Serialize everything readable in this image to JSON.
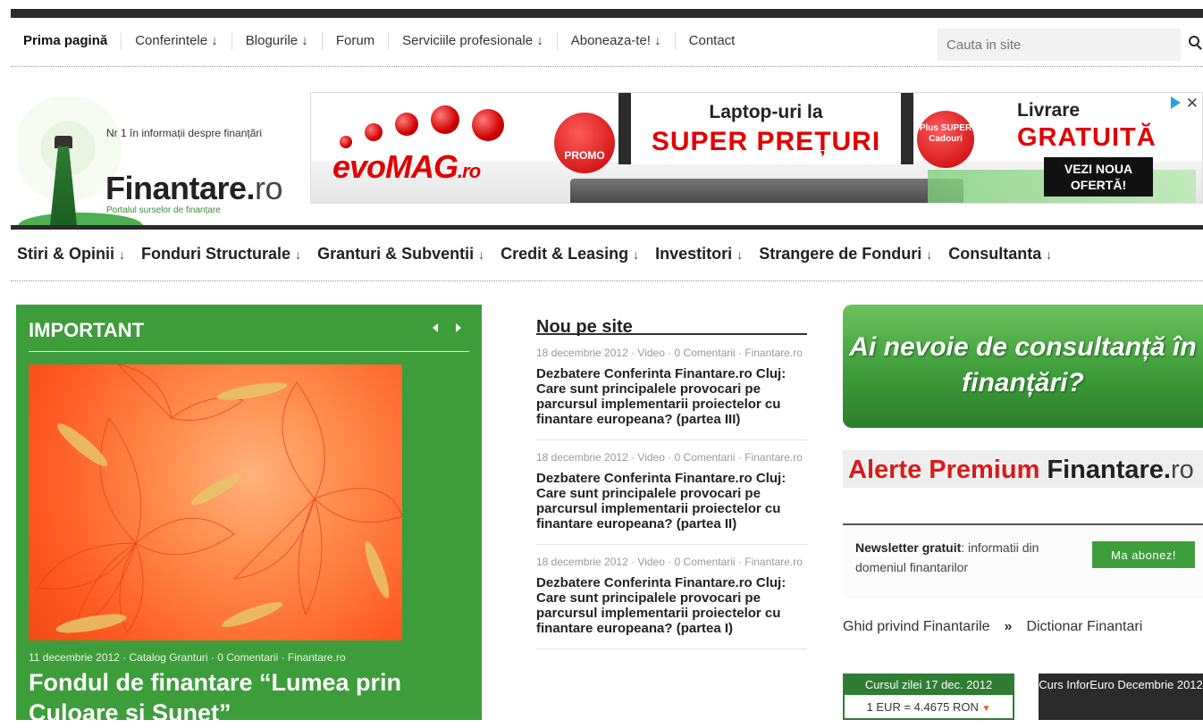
{
  "topnav": {
    "items": [
      "Prima pagină",
      "Conferintele ↓",
      "Blogurile ↓",
      "Forum",
      "Serviciile profesionale ↓",
      "Aboneaza-te! ↓",
      "Contact"
    ],
    "search_placeholder": "Cauta in site"
  },
  "logo": {
    "tagline": "Nr 1 în informații despre finanțări",
    "name": "Finantare.",
    "tld": "ro",
    "sub": "Portalul surselor de finanțare"
  },
  "banner": {
    "brand": "evoMAG",
    "brand_tld": ".ro",
    "promo": "PROMO",
    "line1": "Laptop-uri la",
    "line2": "SUPER PREȚURI",
    "plus_badge": "Plus SUPER Cadouri",
    "right1": "Livrare",
    "right2": "GRATUITĂ",
    "cta": "VEZI NOUA OFERTĂ!",
    "close": "✕"
  },
  "catnav": {
    "items": [
      {
        "label": "Stiri & Opinii",
        "arrow": "↓"
      },
      {
        "label": "Fonduri Structurale",
        "arrow": "↓"
      },
      {
        "label": "Granturi & Subventii",
        "arrow": "↓"
      },
      {
        "label": "Credit & Leasing",
        "arrow": "↓"
      },
      {
        "label": "Investitori",
        "arrow": "↓"
      },
      {
        "label": "Strangere de Fonduri",
        "arrow": "↓"
      },
      {
        "label": "Consultanta",
        "arrow": "↓"
      }
    ]
  },
  "important": {
    "title": "IMPORTANT",
    "meta": "11 decembrie 2012 · Catalog Granturi · 0 Comentarii · Finantare.ro",
    "headline": "Fondul de finantare “Lumea prin Culoare si Sunet”"
  },
  "nou": {
    "title": "Nou pe site",
    "items": [
      {
        "meta": "18 decembrie 2012 · Video · 0 Comentarii · Finantare.ro",
        "headline": "Dezbatere Conferinta Finantare.ro Cluj: Care sunt principalele provocari pe parcursul implementarii proiectelor cu finantare europeana? (partea III)"
      },
      {
        "meta": "18 decembrie 2012 · Video · 0 Comentarii · Finantare.ro",
        "headline": "Dezbatere Conferinta Finantare.ro Cluj: Care sunt principalele provocari pe parcursul implementarii proiectelor cu finantare europeana? (partea II)"
      },
      {
        "meta": "18 decembrie 2012 · Video · 0 Comentarii · Finantare.ro",
        "headline": "Dezbatere Conferinta Finantare.ro Cluj: Care sunt principalele provocari pe parcursul implementarii proiectelor cu finantare europeana? (partea I)"
      }
    ]
  },
  "consult": {
    "text": "Ai nevoie de consultanță în finanțări?"
  },
  "alerte": {
    "red": "Alerte Premium",
    "brand": "Finantare.",
    "tld": "ro"
  },
  "newsletter": {
    "bold": "Newsletter gratuit",
    "text": ": informatii din domeniul finantarilor",
    "button": "Ma abonez!"
  },
  "ghid": {
    "link1": "Ghid privind Finantarile",
    "sep": "»",
    "link2": "Dictionar Finantari"
  },
  "curs": {
    "head": "Cursul zilei 17 dec. 2012",
    "value": "1 EUR = 4.4675 RON",
    "trend_icon": "▼"
  },
  "inforeuro": {
    "text": "Curs InforEuro Decembrie 2012"
  },
  "colors": {
    "green": "#3e9d3b",
    "dark": "#2b2b2b",
    "red": "#d81b1b"
  }
}
